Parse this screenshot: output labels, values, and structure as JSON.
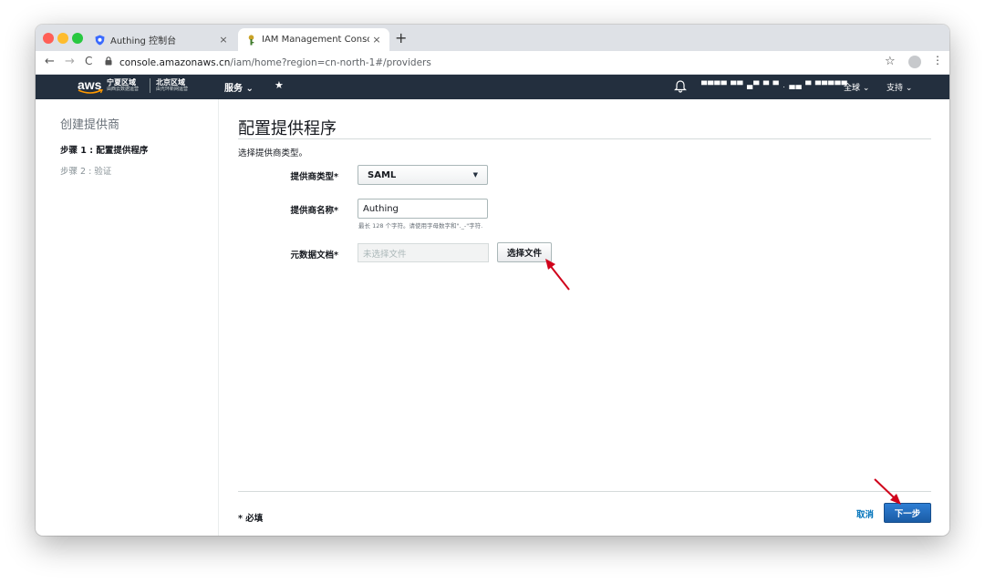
{
  "browser": {
    "tabs": [
      {
        "title": "Authing 控制台",
        "close": "×"
      },
      {
        "title": "IAM Management Console",
        "close": "×"
      }
    ],
    "new_tab": "+",
    "nav": {
      "back": "←",
      "forward": "→",
      "reload": "C"
    },
    "url": {
      "host": "console.amazonaws.cn",
      "path": "/iam/home?region=cn-north-1#/providers"
    },
    "bookmark_icon": "☆",
    "menu_icon": "⋮"
  },
  "aws_nav": {
    "logo_text": "aws",
    "regions": [
      {
        "name": "宁夏区域",
        "sub": "由西云数据运营"
      },
      {
        "name": "北京区域",
        "sub": "由光环新网运营"
      }
    ],
    "services": "服务 ⌄",
    "pin_icon": "★",
    "account": "▀▀▀▀ ▀▀ ▄▀ ▀ ▀ . ▄▄ ▀ ▀▀▀▀▀  ⌄",
    "global": "全球 ⌄",
    "support": "支持 ⌄"
  },
  "sidebar": {
    "title": "创建提供商",
    "steps": [
      "步骤 1 : 配置提供程序",
      "步骤 2 : 验证"
    ]
  },
  "main": {
    "title": "配置提供程序",
    "description": "选择提供商类型。",
    "fields": {
      "provider_type": {
        "label": "提供商类型*",
        "value": "SAML"
      },
      "provider_name": {
        "label": "提供商名称*",
        "value": "Authing",
        "hint": "最长 128 个字符。请使用字母数字和\"._-\"字符."
      },
      "metadata": {
        "label": "元数据文档*",
        "placeholder": "未选择文件",
        "button": "选择文件"
      }
    }
  },
  "footer": {
    "required_note": "* 必填",
    "cancel": "取消",
    "next": "下一步"
  },
  "colors": {
    "aws_nav_bg": "#232f3e",
    "aws_orange": "#ff9900",
    "primary_button": "#1b5ca5",
    "link": "#0073bb",
    "annotation_arrow": "#d0021b"
  }
}
